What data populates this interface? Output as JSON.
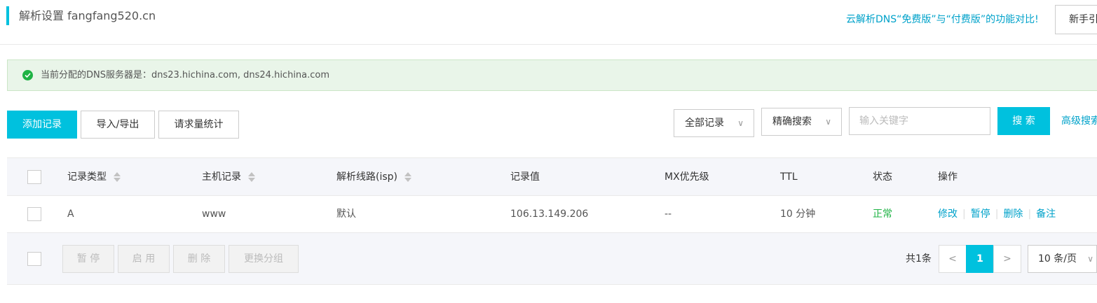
{
  "header": {
    "title": "解析设置 fangfang520.cn",
    "compare_link": "云解析DNS“免费版”与“付费版”的功能对比!",
    "guide_button": "新手引"
  },
  "notice": {
    "text": "当前分配的DNS服务器是：dns23.hichina.com, dns24.hichina.com"
  },
  "toolbar": {
    "add_record": "添加记录",
    "import_export": "导入/导出",
    "request_stats": "请求量统计",
    "record_filter": "全部记录",
    "search_mode": "精确搜索",
    "search_placeholder": "输入关键字",
    "search_button": "搜 索",
    "advanced_search": "高级搜索"
  },
  "table": {
    "columns": {
      "type": "记录类型",
      "host": "主机记录",
      "line": "解析线路(isp)",
      "value": "记录值",
      "mx": "MX优先级",
      "ttl": "TTL",
      "status": "状态",
      "actions": "操作"
    },
    "rows": [
      {
        "type": "A",
        "host": "www",
        "line": "默认",
        "value": "106.13.149.206",
        "mx": "--",
        "ttl": "10 分钟",
        "status": "正常",
        "actions": [
          "修改",
          "暂停",
          "删除",
          "备注"
        ]
      }
    ]
  },
  "bulk": {
    "pause": "暂 停",
    "enable": "启 用",
    "delete": "删 除",
    "change_group": "更换分组"
  },
  "pagination": {
    "total": "共1条",
    "prev": "<",
    "current": "1",
    "next": ">",
    "page_size": "10 条/页"
  },
  "colors": {
    "accent": "#00c1de",
    "link": "#00a2ca",
    "success": "#1fb345",
    "notice_bg": "#e9f5e9"
  }
}
